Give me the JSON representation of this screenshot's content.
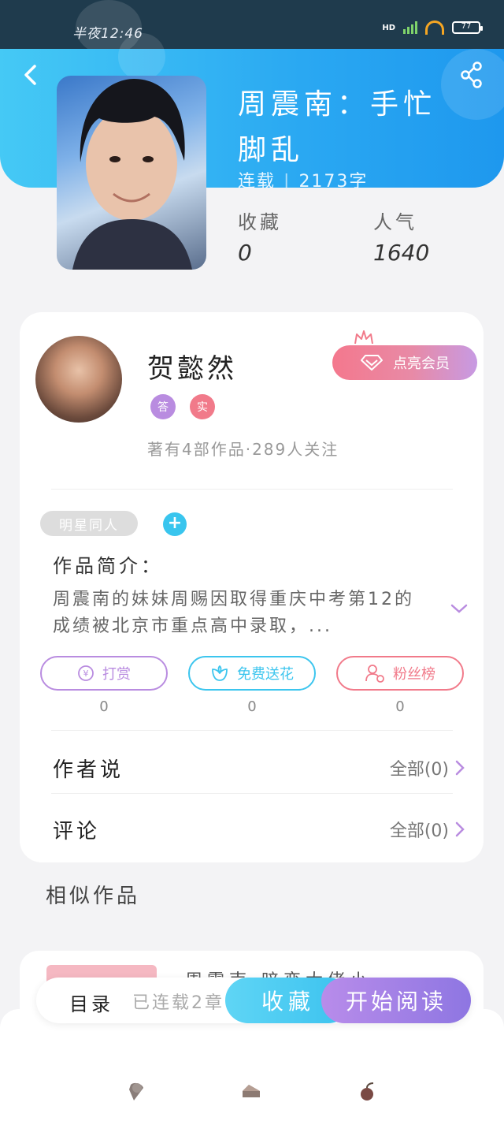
{
  "status_bar": {
    "time": "半夜12:46",
    "network": "HD",
    "battery": "77"
  },
  "book": {
    "title": "周震南：手忙脚乱",
    "status": "连载",
    "word_count": "2173字",
    "favorites_label": "收藏",
    "favorites_value": "0",
    "popularity_label": "人气",
    "popularity_value": "1640"
  },
  "author": {
    "name": "贺懿然",
    "badges": [
      "答",
      "实"
    ],
    "stats": "著有4部作品·289人关注",
    "vip_button": "点亮会员"
  },
  "tags": [
    "明星同人"
  ],
  "intro": {
    "label": "作品简介：",
    "text": "周震南的妹妹周赐因取得重庆中考第12的成绩被北京市重点高中录取，..."
  },
  "actions": [
    {
      "label": "打赏",
      "count": "0",
      "color": "#b98ce0",
      "icon": "yuan-coin-icon"
    },
    {
      "label": "免费送花",
      "count": "0",
      "color": "#3cc5ee",
      "icon": "flower-icon"
    },
    {
      "label": "粉丝榜",
      "count": "0",
      "color": "#f17a8a",
      "icon": "user-rank-icon"
    }
  ],
  "rows": {
    "author_says": {
      "label": "作者说",
      "link": "全部(0)"
    },
    "comments": {
      "label": "评论",
      "link": "全部(0)"
    }
  },
  "similar": {
    "title": "相似作品",
    "first_item": "周震南·暗恋大佬小"
  },
  "action_bar": {
    "toc": "目录",
    "serial_status": "已连载2章",
    "favorite": "收藏",
    "start_reading": "开始阅读"
  },
  "bottom_nav": [
    "ice-cream-icon",
    "cake-icon",
    "cherry-icon"
  ],
  "colors": {
    "header_start": "#45c9f5",
    "header_end": "#1e98ee",
    "favorite_button": "#3bc2ef",
    "read_button": "#8e76e2",
    "vip_start": "#f4788d",
    "vip_end": "#c79ae3"
  }
}
